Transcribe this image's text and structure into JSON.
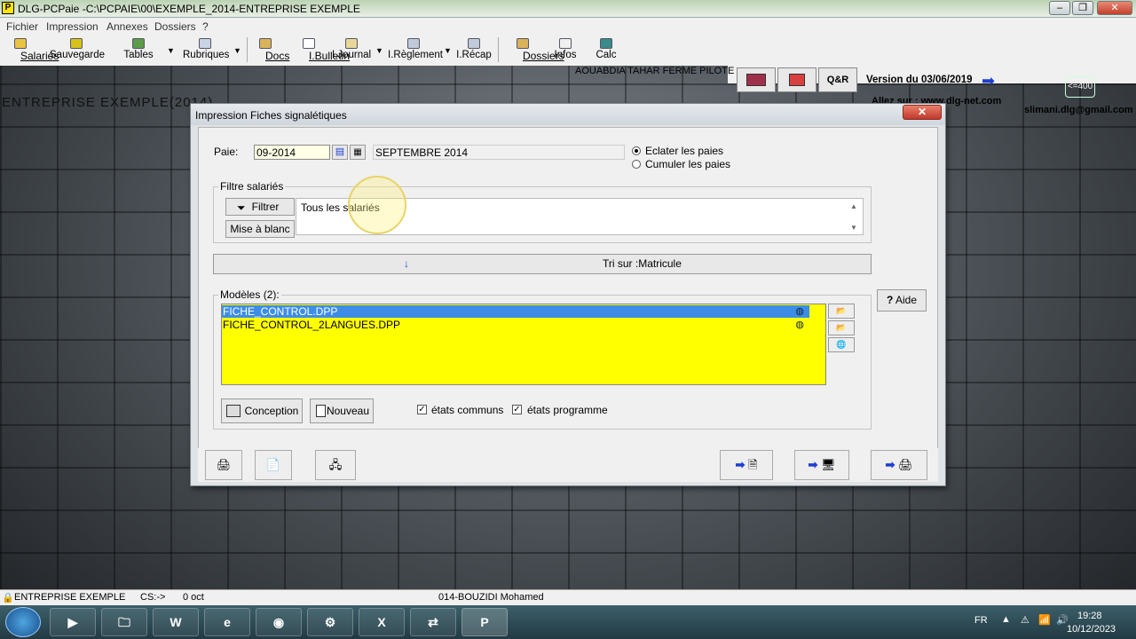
{
  "window": {
    "title": "DLG-PCPaie -C:\\PCPAIE\\00\\EXEMPLE_2014-ENTREPRISE EXEMPLE",
    "min": "‒",
    "max": "❐",
    "close": "✕",
    "app_icon": "P"
  },
  "menu": [
    "Fichier",
    "Impression",
    "Annexes",
    "Dossiers",
    "?"
  ],
  "toolbar": [
    "Salariés",
    "Sauvegarde",
    "Tables",
    "Rubriques",
    "Docs",
    "I.Bulletin",
    "I.Journal",
    "I.Règlement",
    "I.Récap",
    "Dossiers",
    "Infos",
    "Calc"
  ],
  "header": {
    "company_line": "AOUABDIA TAHAR FERME PILOTE",
    "qr": "Q&R",
    "version": "Version du 03/06/2019",
    "web": "Allez sur : www.dlg-net.com",
    "email": "slimani.dlg@gmail.com",
    "badge": "<=400",
    "enterprise_title": "ENTREPRISE EXEMPLE(2014)"
  },
  "dialog": {
    "title": "Impression Fiches signalétiques",
    "close": "✕",
    "paie_label": "Paie:",
    "paie_value": "09-2014",
    "paie_month": "SEPTEMBRE 2014",
    "radio1": "Eclater les paies",
    "radio2": "Cumuler les paies",
    "filter_group": "Filtre salariés",
    "filter_button": "Filtrer",
    "reset_button": "Mise à blanc",
    "filter_text": "Tous les salariés",
    "sort_label": "Tri sur :Matricule",
    "sort_icon": "↓",
    "models_group": "Modèles (2):",
    "models": [
      "FICHE_CONTROL.DPP",
      "FICHE_CONTROL_2LANGUES.DPP"
    ],
    "aide": "Aide",
    "aide_icon": "?",
    "conception": "Conception",
    "nouveau": "Nouveau",
    "check1": "états communs",
    "check2": "états programme",
    "check_mark": "✓"
  },
  "statusbar": {
    "enterprise": "ENTREPRISE EXEMPLE",
    "cs": "CS:->",
    "size": "0 oct",
    "employee": "014-BOUZIDI Mohamed"
  },
  "taskbar": {
    "lang": "FR",
    "time": "19:28",
    "date": "10/12/2023",
    "apps": [
      "Media",
      "Explorer",
      "Word",
      "IE",
      "Chrome",
      "App",
      "Excel",
      "Teamviewer",
      "PCPaie"
    ]
  },
  "colors": {
    "list_bg": "#ffff00",
    "selection": "#3d8de6"
  }
}
